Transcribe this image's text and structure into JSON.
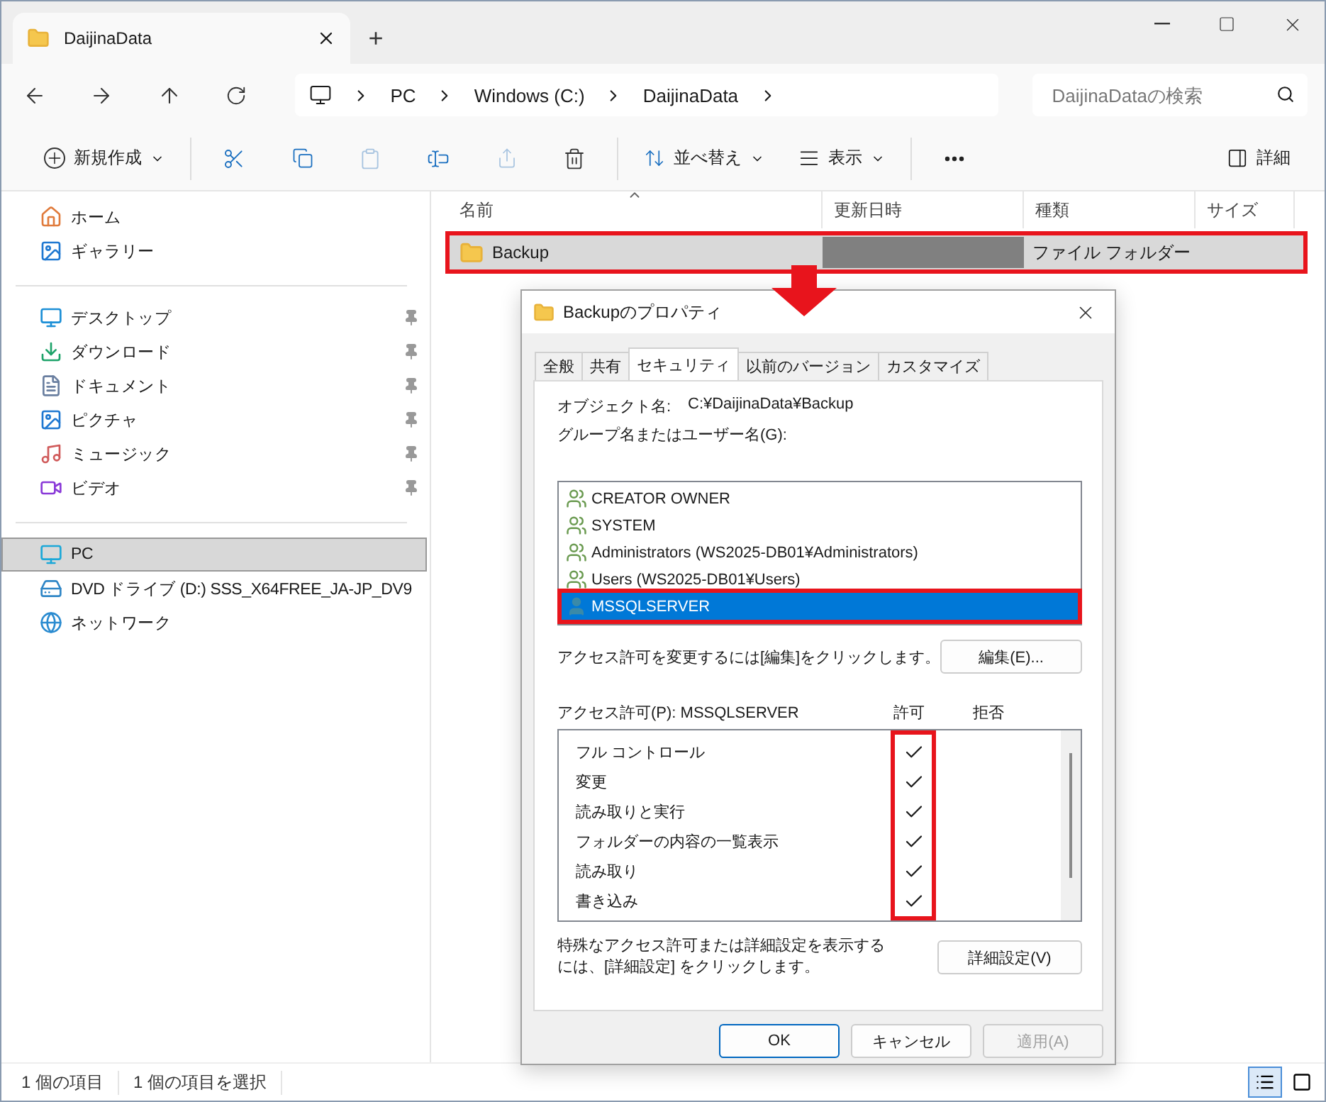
{
  "window": {
    "tab_title": "DaijinaData",
    "new_tab": "+"
  },
  "nav": {
    "breadcrumb": [
      "PC",
      "Windows (C:)",
      "DaijinaData"
    ],
    "search": {
      "placeholder": "DaijinaDataの検索"
    }
  },
  "toolbar": {
    "new": "新規作成",
    "sort": "並べ替え",
    "view": "表示",
    "details": "詳細"
  },
  "sidebar": {
    "groups": [
      [
        {
          "label": "ホーム",
          "kind": "home",
          "pinned": false,
          "selected": false
        },
        {
          "label": "ギャラリー",
          "kind": "gallery",
          "pinned": false,
          "selected": false
        }
      ],
      [
        {
          "label": "デスクトップ",
          "kind": "desktop",
          "pinned": true,
          "selected": false
        },
        {
          "label": "ダウンロード",
          "kind": "download",
          "pinned": true,
          "selected": false
        },
        {
          "label": "ドキュメント",
          "kind": "document",
          "pinned": true,
          "selected": false
        },
        {
          "label": "ピクチャ",
          "kind": "picture",
          "pinned": true,
          "selected": false
        },
        {
          "label": "ミュージック",
          "kind": "music",
          "pinned": true,
          "selected": false
        },
        {
          "label": "ビデオ",
          "kind": "video",
          "pinned": true,
          "selected": false
        }
      ],
      [
        {
          "label": "PC",
          "kind": "pc",
          "pinned": false,
          "selected": true
        },
        {
          "label": "DVD ドライブ (D:) SSS_X64FREE_JA-JP_DV9",
          "kind": "dvd",
          "pinned": false,
          "selected": false
        },
        {
          "label": "ネットワーク",
          "kind": "network",
          "pinned": false,
          "selected": false
        }
      ]
    ]
  },
  "table": {
    "columns": [
      {
        "label": "名前",
        "sorted": true
      },
      {
        "label": "更新日時",
        "sorted": false
      },
      {
        "label": "種類",
        "sorted": false
      },
      {
        "label": "サイズ",
        "sorted": false
      }
    ],
    "rows": [
      {
        "name": "Backup",
        "modified_redacted": true,
        "type": "ファイル フォルダー",
        "selected": true,
        "highlighted": true
      }
    ]
  },
  "annotation_arrow": true,
  "dialog": {
    "title": "Backupのプロパティ",
    "tabs": [
      {
        "label": "全般",
        "selected": false
      },
      {
        "label": "共有",
        "selected": false
      },
      {
        "label": "セキュリティ",
        "selected": true
      },
      {
        "label": "以前のバージョン",
        "selected": false
      },
      {
        "label": "カスタマイズ",
        "selected": false
      }
    ],
    "object_label": "オブジェクト名:",
    "object_value": "C:¥DaijinaData¥Backup",
    "group_label": "グループ名またはユーザー名(G):",
    "users": [
      {
        "name": "CREATOR OWNER",
        "kind": "group",
        "selected": false,
        "highlighted": false
      },
      {
        "name": "SYSTEM",
        "kind": "group",
        "selected": false,
        "highlighted": false
      },
      {
        "name": "Administrators (WS2025-DB01¥Administrators)",
        "kind": "group",
        "selected": false,
        "highlighted": false
      },
      {
        "name": "Users (WS2025-DB01¥Users)",
        "kind": "group",
        "selected": false,
        "highlighted": false
      },
      {
        "name": "MSSQLSERVER",
        "kind": "user",
        "selected": true,
        "highlighted": true
      }
    ],
    "edit_hint": "アクセス許可を変更するには[編集]をクリックします。",
    "edit_button": "編集(E)...",
    "permissions_label": "アクセス許可(P): MSSQLSERVER",
    "allow_header": "許可",
    "deny_header": "拒否",
    "allow_highlighted": true,
    "permissions": [
      {
        "name": "フル コントロール",
        "allow": true,
        "deny": false
      },
      {
        "name": "変更",
        "allow": true,
        "deny": false
      },
      {
        "name": "読み取りと実行",
        "allow": true,
        "deny": false
      },
      {
        "name": "フォルダーの内容の一覧表示",
        "allow": true,
        "deny": false
      },
      {
        "name": "読み取り",
        "allow": true,
        "deny": false
      },
      {
        "name": "書き込み",
        "allow": true,
        "deny": false
      }
    ],
    "advanced_hint": "特殊なアクセス許可または詳細設定を表示するには、[詳細設定] をクリックします。",
    "advanced_button": "詳細設定(V)",
    "buttons": [
      {
        "label": "OK",
        "kind": "default",
        "disabled": false
      },
      {
        "label": "キャンセル",
        "kind": "normal",
        "disabled": false
      },
      {
        "label": "適用(A)",
        "kind": "normal",
        "disabled": true
      }
    ]
  },
  "status_bar": {
    "count": "1 個の項目",
    "selection": "1 個の項目を選択",
    "views": [
      {
        "kind": "details",
        "selected": true
      },
      {
        "kind": "tiles",
        "selected": false
      }
    ]
  }
}
